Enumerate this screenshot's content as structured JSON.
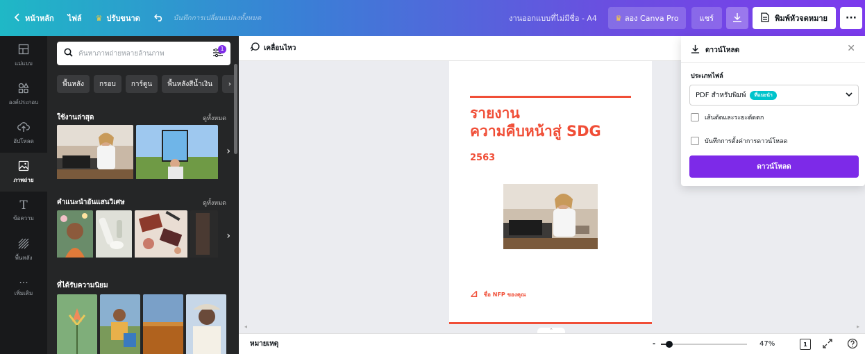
{
  "topbar": {
    "back_label": "หน้าหลัก",
    "file_label": "ไฟล์",
    "resize_label": "ปรับขนาด",
    "autosave_text": "บันทึกการเปลี่ยนแปลงทั้งหมด",
    "doc_name": "งานออกแบบที่ไม่มีชื่อ - A4",
    "pro_label": "ลอง Canva Pro",
    "share_label": "แชร์",
    "print_label": "พิมพ์หัวจดหมาย",
    "more_label": "···"
  },
  "rail": {
    "items": [
      {
        "label": "แม่แบบ",
        "icon": "template-icon"
      },
      {
        "label": "องค์ประกอบ",
        "icon": "elements-icon"
      },
      {
        "label": "อัปโหลด",
        "icon": "upload-icon"
      },
      {
        "label": "ภาพถ่าย",
        "icon": "photo-icon"
      },
      {
        "label": "ข้อความ",
        "icon": "text-icon"
      },
      {
        "label": "พื้นหลัง",
        "icon": "background-icon"
      },
      {
        "label": "เพิ่มเติม",
        "icon": "more-icon"
      }
    ]
  },
  "panel": {
    "search_placeholder": "ค้นหาภาพถ่ายหลายล้านภาพ",
    "filter_count": "1",
    "chips": [
      "พื้นหลัง",
      "กรอบ",
      "การ์ตูน",
      "พื้นหลังสีน้ำเงิน"
    ],
    "sections": [
      {
        "title": "ใช้งานล่าสุด",
        "link": "ดูทั้งหมด"
      },
      {
        "title": "คำแนะนำอันแสนวิเศษ",
        "link": "ดูทั้งหมด"
      },
      {
        "title": "ที่ได้รับความนิยม",
        "link": ""
      }
    ]
  },
  "canvas": {
    "animate_label": "เคลื่อนไหว",
    "page": {
      "title_line1": "รายงาน",
      "title_line2": "ความคืบหน้าสู่ SDG",
      "year": "2563",
      "footer": "ชื่อ NFP ของคุณ"
    }
  },
  "bottombar": {
    "notes_label": "หมายเหตุ",
    "zoom_minus": "-",
    "zoom_percent": "47%",
    "zoom_value": 0.1,
    "page_count": "1"
  },
  "download_panel": {
    "title": "ดาวน์โหลด",
    "file_type_label": "ประเภทไฟล์",
    "file_type_value": "PDF สำหรับพิมพ์",
    "recommended_badge": "ที่แนะนำ",
    "crop_marks_label": "เส้นตัดและระยะตัดตก",
    "save_settings_label": "บันทึกการตั้งค่าการดาวน์โหลด",
    "download_button": "ดาวน์โหลด"
  },
  "colors": {
    "accent": "#7d2ae8",
    "brand_red": "#f04e37",
    "panel_bg": "#252627",
    "rail_bg": "#18191b"
  }
}
